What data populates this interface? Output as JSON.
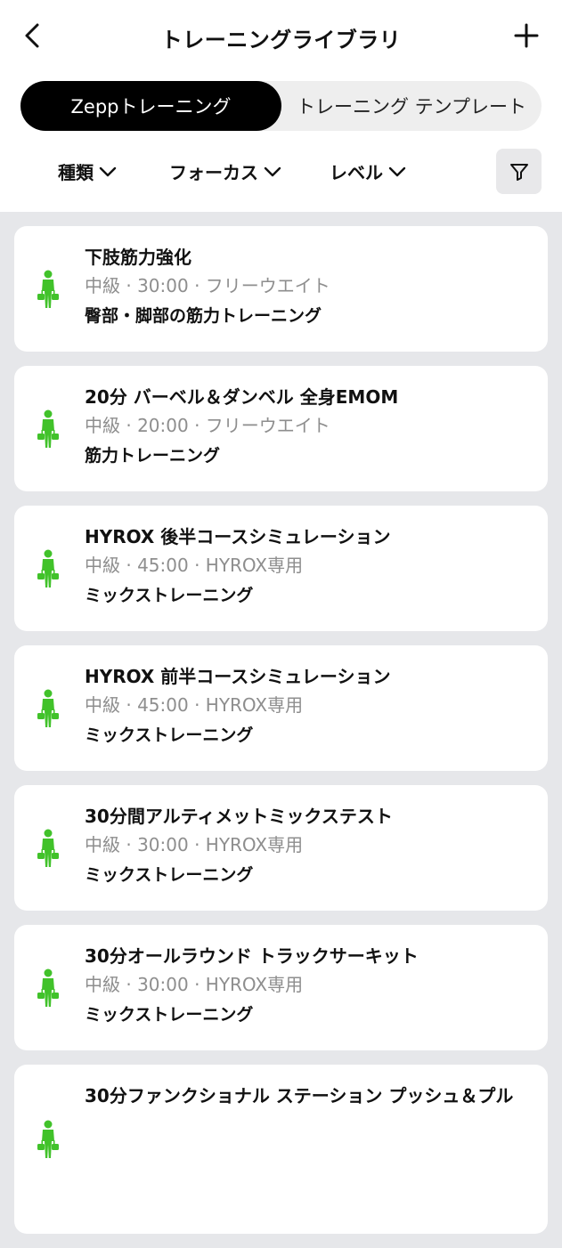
{
  "header": {
    "title": "トレーニングライブラリ"
  },
  "tabs": [
    {
      "label": "Zeppトレーニング",
      "active": true
    },
    {
      "label": "トレーニング テンプレート",
      "active": false
    }
  ],
  "filters": {
    "type_label": "種類",
    "focus_label": "フォーカス",
    "level_label": "レベル"
  },
  "colors": {
    "accent_green": "#41c22a",
    "active_tab_bg": "#000000"
  },
  "workouts": [
    {
      "name": "下肢筋力強化",
      "meta": "中級 · 30:00 · フリーウエイト",
      "category": "臀部・脚部の筋力トレーニング",
      "icon": "person-dumbbell-icon"
    },
    {
      "name": "20分 バーベル＆ダンベル 全身EMOM",
      "meta": "中級 · 20:00 · フリーウエイト",
      "category": "筋力トレーニング",
      "icon": "person-dumbbell-icon"
    },
    {
      "name": "HYROX 後半コースシミュレーション",
      "meta": "中級 · 45:00 · HYROX専用",
      "category": "ミックストレーニング",
      "icon": "person-dumbbell-icon"
    },
    {
      "name": "HYROX 前半コースシミュレーション",
      "meta": "中級 · 45:00 · HYROX専用",
      "category": "ミックストレーニング",
      "icon": "person-dumbbell-icon"
    },
    {
      "name": "30分間アルティメットミックステスト",
      "meta": "中級 · 30:00 · HYROX専用",
      "category": "ミックストレーニング",
      "icon": "person-dumbbell-icon"
    },
    {
      "name": "30分オールラウンド トラックサーキット",
      "meta": "中級 · 30:00 · HYROX専用",
      "category": "ミックストレーニング",
      "icon": "person-dumbbell-icon"
    },
    {
      "name": "30分ファンクショナル ステーション プッシュ＆プル",
      "meta": "",
      "category": "",
      "icon": "person-dumbbell-icon"
    }
  ]
}
